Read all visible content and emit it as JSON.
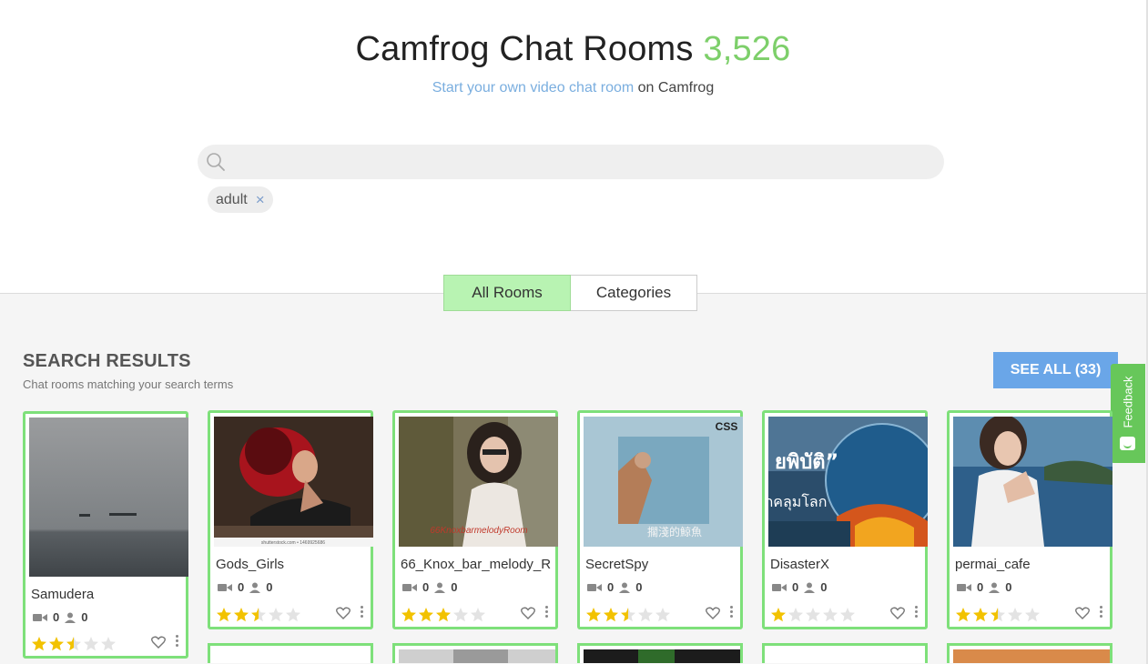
{
  "header": {
    "title": "Camfrog Chat Rooms",
    "count": "3,526",
    "subtitle_link": "Start your own video chat room",
    "subtitle_rest": " on Camfrog"
  },
  "search": {
    "value": "",
    "placeholder": "",
    "icon": "search-icon"
  },
  "filter_tag": {
    "label": "adult",
    "remove": "×"
  },
  "tabs": [
    {
      "label": "All Rooms",
      "active": true
    },
    {
      "label": "Categories",
      "active": false
    }
  ],
  "results": {
    "title": "SEARCH RESULTS",
    "subtitle": "Chat rooms matching your search terms",
    "see_all": "SEE ALL (33)"
  },
  "feedback": {
    "label": "Feedback"
  },
  "rooms": [
    {
      "name": "Samudera",
      "video": "0",
      "users": "0",
      "rating": 2.5
    },
    {
      "name": "Gods_Girls",
      "video": "0",
      "users": "0",
      "rating": 2.5
    },
    {
      "name": "66_Knox_bar_melody_R",
      "video": "0",
      "users": "0",
      "rating": 3
    },
    {
      "name": "SecretSpy",
      "video": "0",
      "users": "0",
      "rating": 2.5
    },
    {
      "name": "DisasterX",
      "video": "0",
      "users": "0",
      "rating": 1
    },
    {
      "name": "permai_cafe",
      "video": "0",
      "users": "0",
      "rating": 2.5
    }
  ],
  "thumb_text": {
    "gods_girls": "shutterstock.com • 1469925686",
    "knox": "66KnoxbarmelodyRoom",
    "secretspy_logo": "CSS",
    "secretspy_caption": "擱淺的鯨魚",
    "disaster_1": "ยพิบัติ”",
    "disaster_2": "กคลุมโลก"
  },
  "colors": {
    "accent_green": "#7ee07a",
    "count_green": "#7dcf6a",
    "link_blue": "#7aaedf",
    "button_blue": "#6aa6e8",
    "star": "#f2c200"
  }
}
